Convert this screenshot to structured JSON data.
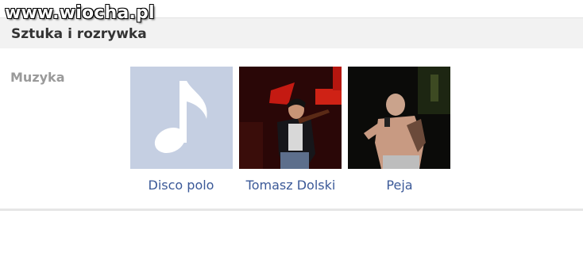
{
  "watermark": {
    "text": "www.wiocha.pl"
  },
  "section": {
    "title": "Sztuka i rozrywka"
  },
  "music": {
    "label": "Muzyka",
    "items": [
      {
        "name": "Disco polo",
        "thumbnail": "music-note-placeholder"
      },
      {
        "name": "Tomasz Dolski",
        "thumbnail": "photo-violinist-on-stage"
      },
      {
        "name": "Peja",
        "thumbnail": "photo-rapper-with-microphone"
      }
    ]
  },
  "colors": {
    "link": "#3b5998",
    "label": "#9a9a9a",
    "placeholder": "#c5cfe2",
    "header_bg": "#f2f2f2"
  }
}
